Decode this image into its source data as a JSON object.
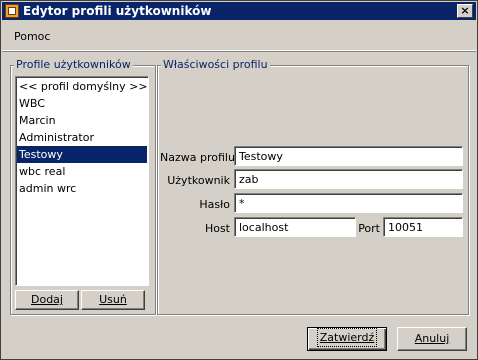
{
  "window": {
    "title": "Edytor profili użytkowników",
    "close_glyph": "×"
  },
  "menu": {
    "help": "Pomoc"
  },
  "profiles": {
    "legend": "Profile użytkowników",
    "items": [
      {
        "label": "<< profil domyślny >>"
      },
      {
        "label": "WBC"
      },
      {
        "label": "Marcin"
      },
      {
        "label": "Administrator"
      },
      {
        "label": "Testowy",
        "selected": true
      },
      {
        "label": "wbc real"
      },
      {
        "label": "admin wrc"
      }
    ],
    "add_label": "Dodaj",
    "remove_label": "Usuń"
  },
  "properties": {
    "legend": "Właściwości profilu",
    "profile_name_label": "Nazwa profilu",
    "profile_name_value": "Testowy",
    "user_label": "Użytkownik",
    "user_value": "zab",
    "password_label": "Hasło",
    "password_value": "*",
    "host_label": "Host",
    "host_value": "localhost",
    "port_label": "Port",
    "port_value": "10051"
  },
  "buttons": {
    "ok": "Zatwierdź",
    "cancel": "Anuluj"
  }
}
